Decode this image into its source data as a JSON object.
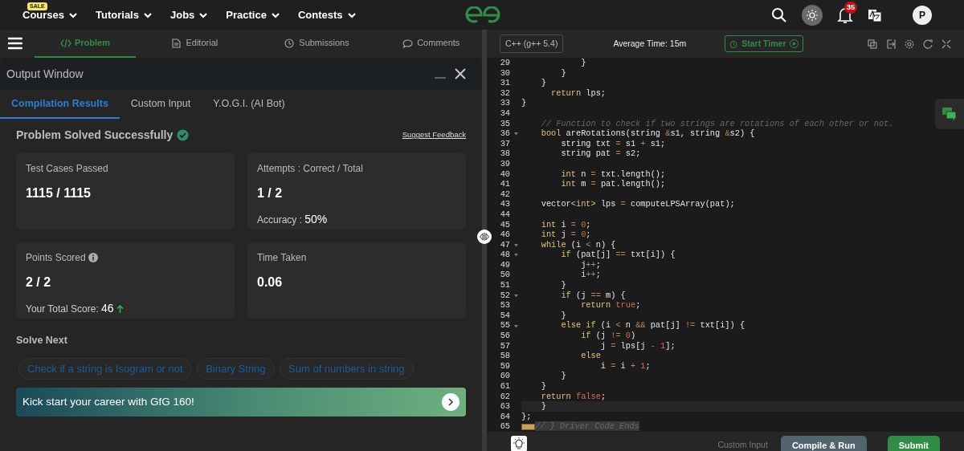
{
  "topnav": {
    "sale_badge": "SALE",
    "menus": [
      {
        "label": "Courses"
      },
      {
        "label": "Tutorials"
      },
      {
        "label": "Jobs"
      },
      {
        "label": "Practice"
      },
      {
        "label": "Contests"
      }
    ],
    "notification_count": "35",
    "avatar": "P"
  },
  "problem_tabs": [
    {
      "label": "Problem",
      "kind": "code",
      "selected": true
    },
    {
      "label": "Editorial",
      "kind": "doc",
      "selected": false
    },
    {
      "label": "Submissions",
      "kind": "clock",
      "selected": false
    },
    {
      "label": "Comments",
      "kind": "chat",
      "selected": false
    }
  ],
  "output_window": {
    "title": "Output Window",
    "tabs": [
      {
        "label": "Compilation Results",
        "selected": true
      },
      {
        "label": "Custom Input",
        "selected": false
      },
      {
        "label": "Y.O.G.I. (AI Bot)",
        "selected": false
      }
    ],
    "status": "Problem Solved Successfully",
    "feedback_link": "Suggest Feedback",
    "stats": [
      {
        "label": "Test Cases Passed",
        "value": "1115 / 1115"
      },
      {
        "label": "Attempts : Correct / Total",
        "value": "1 / 2",
        "note_label": "Accuracy :",
        "note_value": "50%"
      },
      {
        "label": "Points Scored",
        "info": true,
        "value": "2 / 2",
        "note_label": "Your Total Score:",
        "note_value": "46",
        "trend_up": true
      },
      {
        "label": "Time Taken",
        "value": "0.06"
      }
    ],
    "solve_next_title": "Solve Next",
    "suggestions": [
      "Check if a string is Isogram or not",
      "Binary String",
      "Sum of numbers in string"
    ],
    "banner": "Kick start your career with GfG 160!"
  },
  "editor": {
    "language": "C++ (g++ 5.4)",
    "average_time": "Average Time: 15m",
    "timer_button": "Start Timer",
    "lines": [
      {
        "no": "29",
        "tokens": [
          {
            "kind": "plain",
            "text": "            }"
          }
        ]
      },
      {
        "no": "30",
        "tokens": [
          {
            "kind": "plain",
            "text": "        }"
          }
        ]
      },
      {
        "no": "31",
        "tokens": [
          {
            "kind": "plain",
            "text": "    }"
          }
        ]
      },
      {
        "no": "32",
        "tokens": [
          {
            "kind": "kw",
            "text": "      return"
          },
          {
            "kind": "plain",
            "text": " lps;"
          }
        ]
      },
      {
        "no": "33",
        "tokens": [
          {
            "kind": "plain",
            "text": "}"
          }
        ]
      },
      {
        "no": "34"
      },
      {
        "no": "35",
        "tokens": [
          {
            "kind": "comment",
            "text": "    // Function to check if two strings are rotations of each other or not."
          }
        ]
      },
      {
        "no": "36",
        "foldable": true,
        "tokens": [
          {
            "kind": "kw",
            "text": "    bool"
          },
          {
            "kind": "plain",
            "text": " areRotations(string "
          },
          {
            "kind": "op",
            "text": "&"
          },
          {
            "kind": "plain",
            "text": "s1, string "
          },
          {
            "kind": "op",
            "text": "&"
          },
          {
            "kind": "plain",
            "text": "s2) {"
          }
        ]
      },
      {
        "no": "37",
        "tokens": [
          {
            "kind": "plain",
            "text": "        string txt "
          },
          {
            "kind": "op",
            "text": "="
          },
          {
            "kind": "plain",
            "text": " s1 "
          },
          {
            "kind": "op",
            "text": "+"
          },
          {
            "kind": "plain",
            "text": " s1;"
          }
        ]
      },
      {
        "no": "38",
        "tokens": [
          {
            "kind": "plain",
            "text": "        string pat "
          },
          {
            "kind": "op",
            "text": "="
          },
          {
            "kind": "plain",
            "text": " s2;"
          }
        ]
      },
      {
        "no": "39"
      },
      {
        "no": "40",
        "tokens": [
          {
            "kind": "kw",
            "text": "        int"
          },
          {
            "kind": "plain",
            "text": " n "
          },
          {
            "kind": "op",
            "text": "="
          },
          {
            "kind": "plain",
            "text": " txt.length();"
          }
        ]
      },
      {
        "no": "41",
        "tokens": [
          {
            "kind": "kw",
            "text": "        int"
          },
          {
            "kind": "plain",
            "text": " m "
          },
          {
            "kind": "op",
            "text": "="
          },
          {
            "kind": "plain",
            "text": " pat.length();"
          }
        ]
      },
      {
        "no": "42"
      },
      {
        "no": "43",
        "tokens": [
          {
            "kind": "plain",
            "text": "    vector"
          },
          {
            "kind": "kw",
            "text": "<int>"
          },
          {
            "kind": "plain",
            "text": " lps "
          },
          {
            "kind": "op",
            "text": "="
          },
          {
            "kind": "plain",
            "text": " computeLPSArray(pat);"
          }
        ]
      },
      {
        "no": "44"
      },
      {
        "no": "45",
        "tokens": [
          {
            "kind": "kw",
            "text": "    int"
          },
          {
            "kind": "plain",
            "text": " i "
          },
          {
            "kind": "op",
            "text": "= "
          },
          {
            "kind": "num",
            "text": "0"
          },
          {
            "kind": "plain",
            "text": ";"
          }
        ]
      },
      {
        "no": "46",
        "tokens": [
          {
            "kind": "kw",
            "text": "    int"
          },
          {
            "kind": "plain",
            "text": " j "
          },
          {
            "kind": "op",
            "text": "= "
          },
          {
            "kind": "num",
            "text": "0"
          },
          {
            "kind": "plain",
            "text": ";"
          }
        ]
      },
      {
        "no": "47",
        "foldable": true,
        "tokens": [
          {
            "kind": "kw",
            "text": "    while"
          },
          {
            "kind": "plain",
            "text": " (i "
          },
          {
            "kind": "op",
            "text": "<"
          },
          {
            "kind": "plain",
            "text": " n) {"
          }
        ]
      },
      {
        "no": "48",
        "foldable": true,
        "tokens": [
          {
            "kind": "kw",
            "text": "        if"
          },
          {
            "kind": "plain",
            "text": " (pat[j] "
          },
          {
            "kind": "op",
            "text": "=="
          },
          {
            "kind": "plain",
            "text": " txt[i]) {"
          }
        ]
      },
      {
        "no": "49",
        "tokens": [
          {
            "kind": "plain",
            "text": "            j"
          },
          {
            "kind": "op",
            "text": "++"
          },
          {
            "kind": "plain",
            "text": ";"
          }
        ]
      },
      {
        "no": "50",
        "tokens": [
          {
            "kind": "plain",
            "text": "            i"
          },
          {
            "kind": "op",
            "text": "++"
          },
          {
            "kind": "plain",
            "text": ";"
          }
        ]
      },
      {
        "no": "51",
        "tokens": [
          {
            "kind": "plain",
            "text": "        }"
          }
        ]
      },
      {
        "no": "52",
        "foldable": true,
        "tokens": [
          {
            "kind": "kw",
            "text": "        if"
          },
          {
            "kind": "plain",
            "text": " (j "
          },
          {
            "kind": "op",
            "text": "=="
          },
          {
            "kind": "plain",
            "text": " m) {"
          }
        ]
      },
      {
        "no": "53",
        "tokens": [
          {
            "kind": "kw",
            "text": "            return "
          },
          {
            "kind": "num",
            "text": "true"
          },
          {
            "kind": "plain",
            "text": ";"
          }
        ]
      },
      {
        "no": "54",
        "tokens": [
          {
            "kind": "plain",
            "text": "        }"
          }
        ]
      },
      {
        "no": "55",
        "foldable": true,
        "tokens": [
          {
            "kind": "kw",
            "text": "        else if"
          },
          {
            "kind": "plain",
            "text": " (i "
          },
          {
            "kind": "op",
            "text": "<"
          },
          {
            "kind": "plain",
            "text": " n "
          },
          {
            "kind": "op",
            "text": "&&"
          },
          {
            "kind": "plain",
            "text": " pat[j] "
          },
          {
            "kind": "op",
            "text": "!="
          },
          {
            "kind": "plain",
            "text": " txt[i]) {"
          }
        ]
      },
      {
        "no": "56",
        "tokens": [
          {
            "kind": "kw",
            "text": "            if"
          },
          {
            "kind": "plain",
            "text": " (j "
          },
          {
            "kind": "op",
            "text": "!= "
          },
          {
            "kind": "num",
            "text": "0"
          },
          {
            "kind": "plain",
            "text": ")"
          }
        ]
      },
      {
        "no": "57",
        "tokens": [
          {
            "kind": "plain",
            "text": "                j "
          },
          {
            "kind": "op",
            "text": "="
          },
          {
            "kind": "plain",
            "text": " lps[j "
          },
          {
            "kind": "op",
            "text": "- "
          },
          {
            "kind": "num",
            "text": "1"
          },
          {
            "kind": "plain",
            "text": "];"
          }
        ]
      },
      {
        "no": "58",
        "tokens": [
          {
            "kind": "kw",
            "text": "            else"
          }
        ]
      },
      {
        "no": "59",
        "tokens": [
          {
            "kind": "plain",
            "text": "                i "
          },
          {
            "kind": "op",
            "text": "="
          },
          {
            "kind": "plain",
            "text": " i "
          },
          {
            "kind": "op",
            "text": "+ "
          },
          {
            "kind": "num",
            "text": "1"
          },
          {
            "kind": "plain",
            "text": ";"
          }
        ]
      },
      {
        "no": "60",
        "tokens": [
          {
            "kind": "plain",
            "text": "        }"
          }
        ]
      },
      {
        "no": "61",
        "tokens": [
          {
            "kind": "plain",
            "text": "    }"
          }
        ]
      },
      {
        "no": "62",
        "tokens": [
          {
            "kind": "kw",
            "text": "    return "
          },
          {
            "kind": "num",
            "text": "false"
          },
          {
            "kind": "plain",
            "text": ";"
          }
        ]
      },
      {
        "no": "63",
        "current": true,
        "tokens": [
          {
            "kind": "plain",
            "text": "    }"
          }
        ]
      },
      {
        "no": "64",
        "tokens": [
          {
            "kind": "plain",
            "text": "};"
          }
        ]
      },
      {
        "no": "65",
        "folded": true,
        "tokens": [
          {
            "kind": "comment",
            "text": "// } Driver Code Ends"
          }
        ]
      }
    ],
    "custom_input": "Custom Input",
    "compile_button": "Compile & Run",
    "submit_button": "Submit"
  }
}
